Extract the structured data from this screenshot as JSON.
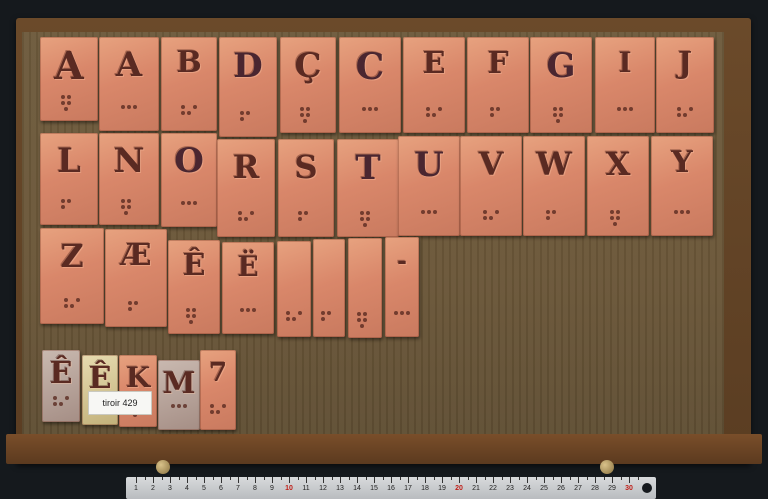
{
  "label": {
    "text": "tiroir 429"
  },
  "blocks": [
    {
      "glyph": "A"
    },
    {
      "glyph": "A"
    },
    {
      "glyph": "B"
    },
    {
      "glyph": "D"
    },
    {
      "glyph": "Ç"
    },
    {
      "glyph": "C"
    },
    {
      "glyph": "E"
    },
    {
      "glyph": "F"
    },
    {
      "glyph": "G"
    },
    {
      "glyph": "I"
    },
    {
      "glyph": "J"
    },
    {
      "glyph": "L"
    },
    {
      "glyph": "N"
    },
    {
      "glyph": "O"
    },
    {
      "glyph": "R"
    },
    {
      "glyph": "S"
    },
    {
      "glyph": "T"
    },
    {
      "glyph": "U"
    },
    {
      "glyph": "V"
    },
    {
      "glyph": "W"
    },
    {
      "glyph": "X"
    },
    {
      "glyph": "Y"
    },
    {
      "glyph": "Z"
    },
    {
      "glyph": "Æ"
    },
    {
      "glyph": "Ê"
    },
    {
      "glyph": "Ë"
    },
    {
      "glyph": ""
    },
    {
      "glyph": ""
    },
    {
      "glyph": ""
    },
    {
      "glyph": "-"
    },
    {
      "glyph": "Ê"
    },
    {
      "glyph": "Ê"
    },
    {
      "glyph": "K"
    },
    {
      "glyph": "M"
    },
    {
      "glyph": "7"
    }
  ],
  "ruler": {
    "numbers": [
      "1",
      "2",
      "3",
      "4",
      "5",
      "6",
      "7",
      "8",
      "9",
      "10",
      "11",
      "12",
      "13",
      "14",
      "15",
      "16",
      "17",
      "18",
      "19",
      "20",
      "21",
      "22",
      "23",
      "24",
      "25",
      "26",
      "27",
      "28",
      "29",
      "30"
    ],
    "red_numbers": [
      "10",
      "20",
      "30"
    ]
  },
  "colors": {
    "copper": "#d9876a",
    "drawer_wood": "#6d5a3c",
    "background": "#15191d"
  }
}
